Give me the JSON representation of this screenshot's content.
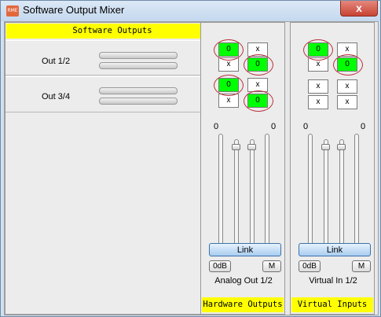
{
  "window": {
    "title": "Software Output Mixer",
    "close_glyph": "x",
    "app_icon": "mixer-app-icon",
    "icon_text": "RME"
  },
  "left_panel": {
    "header": "Software Outputs",
    "rows": [
      {
        "label": "Out 1/2"
      },
      {
        "label": "Out 3/4"
      }
    ]
  },
  "strips": [
    {
      "label": "Analog Out 1/2",
      "footer": "Hardware Outputs",
      "matrix": [
        [
          "0",
          "x"
        ],
        [
          "x",
          "0"
        ],
        [
          "0",
          "x"
        ],
        [
          "x",
          "0"
        ]
      ],
      "level_left": "0",
      "level_right": "0",
      "link_label": "Link",
      "odb_label": "0dB",
      "mute_label": "M"
    },
    {
      "label": "Virtual In 1/2",
      "footer": "Virtual Inputs",
      "matrix": [
        [
          "0",
          "x"
        ],
        [
          "x",
          "0"
        ],
        [
          "x",
          "x"
        ],
        [
          "x",
          "x"
        ]
      ],
      "level_left": "0",
      "level_right": "0",
      "link_label": "Link",
      "odb_label": "0dB",
      "mute_label": "M"
    }
  ],
  "colors": {
    "active_cell": "#00ff00",
    "header_bg": "#ffff00",
    "highlight_ring": "#b8303a"
  }
}
